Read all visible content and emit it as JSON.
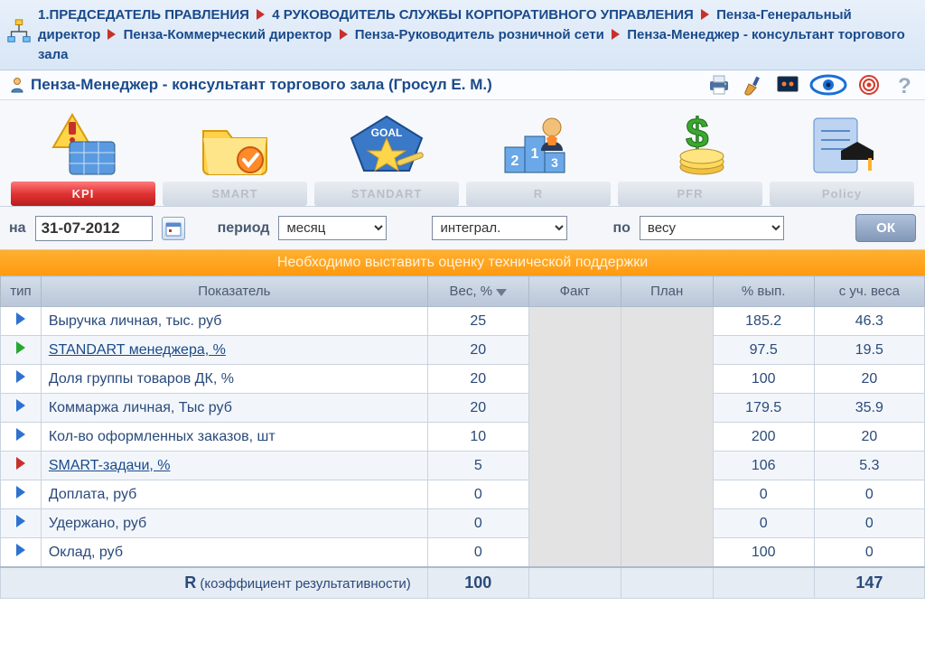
{
  "breadcrumb": {
    "items": [
      "1.ПРЕДСЕДАТЕЛЬ ПРАВЛЕНИЯ",
      "4 РУКОВОДИТЕЛЬ СЛУЖБЫ КОРПОРАТИВНОГО УПРАВЛЕНИЯ",
      "Пенза-Генеральный директор",
      "Пенза-Коммерческий директор",
      "Пенза-Руководитель розничной сети",
      "Пенза-Менеджер - консультант торгового зала"
    ]
  },
  "title": "Пенза-Менеджер - консультант торгового зала  (Гросул Е. М.)",
  "tabs": {
    "kpi": "KPI",
    "smart": "SMART",
    "standart": "STANDART",
    "r": "R",
    "pfr": "PFR",
    "policy": "Policy"
  },
  "filter": {
    "date_label": "на",
    "date_value": "31-07-2012",
    "period_label": "период",
    "period_value": "месяц",
    "mode_value": "интеграл.",
    "by_label": "по",
    "by_value": "весу",
    "ok": "ОК"
  },
  "notice": "Необходимо выставить оценку технической поддержки",
  "columns": {
    "type": "тип",
    "indicator": "Показатель",
    "weight": "Вес, %",
    "fact": "Факт",
    "plan": "План",
    "pct": "% вып.",
    "weighted": "с уч. веса"
  },
  "rows": [
    {
      "arrow": "blue",
      "name": "Выручка личная, тыс. руб",
      "link": false,
      "weight": "25",
      "pct": "185.2",
      "weighted": "46.3"
    },
    {
      "arrow": "green",
      "name": "STANDART менеджера, %",
      "link": true,
      "weight": "20",
      "pct": "97.5",
      "weighted": "19.5"
    },
    {
      "arrow": "blue",
      "name": "Доля группы товаров ДК, %",
      "link": false,
      "weight": "20",
      "pct": "100",
      "weighted": "20"
    },
    {
      "arrow": "blue",
      "name": "Коммаржа личная, Тыс руб",
      "link": false,
      "weight": "20",
      "pct": "179.5",
      "weighted": "35.9"
    },
    {
      "arrow": "blue",
      "name": "Кол-во оформленных заказов, шт",
      "link": false,
      "weight": "10",
      "pct": "200",
      "weighted": "20"
    },
    {
      "arrow": "red",
      "name": "SMART-задачи, %",
      "link": true,
      "weight": "5",
      "pct": "106",
      "weighted": "5.3"
    },
    {
      "arrow": "blue",
      "name": "Доплата, руб",
      "link": false,
      "weight": "0",
      "pct": "0",
      "weighted": "0"
    },
    {
      "arrow": "blue",
      "name": "Удержано, руб",
      "link": false,
      "weight": "0",
      "pct": "0",
      "weighted": "0"
    },
    {
      "arrow": "blue",
      "name": "Оклад, руб",
      "link": false,
      "weight": "0",
      "pct": "100",
      "weighted": "0"
    }
  ],
  "total": {
    "label_prefix": "R",
    "label_rest": " (коэффициент результативности)",
    "weight": "100",
    "weighted": "147"
  }
}
